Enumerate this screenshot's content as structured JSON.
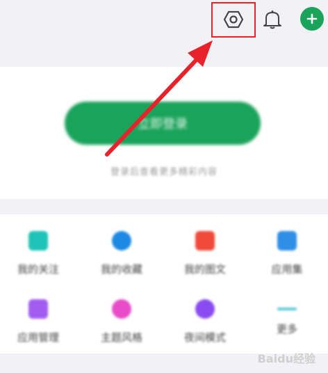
{
  "header": {
    "icons": [
      "gear-icon",
      "bell-icon",
      "plus-icon"
    ],
    "highlight_color": "#e8222a"
  },
  "login": {
    "button_label": "立即登录",
    "tip": "登录后查看更多精彩内容"
  },
  "grid": {
    "items": [
      {
        "label": "我的关注",
        "icon": "follow-icon",
        "color": "#1fc4b8"
      },
      {
        "label": "我的收藏",
        "icon": "star-icon",
        "color": "#1e88e5"
      },
      {
        "label": "我的图文",
        "icon": "document-icon",
        "color": "#f04a3a"
      },
      {
        "label": "应用集",
        "icon": "apps-icon",
        "color": "#2f8fe6"
      },
      {
        "label": "应用管理",
        "icon": "manage-icon",
        "color": "#a35cf0"
      },
      {
        "label": "主题风格",
        "icon": "theme-icon",
        "color": "#e84cc8"
      },
      {
        "label": "夜间模式",
        "icon": "moon-icon",
        "color": "#8a4cf0"
      },
      {
        "label": "更多",
        "icon": "more-icon",
        "color": "#57c9d6"
      }
    ]
  },
  "watermark": "Baidu经验",
  "colors": {
    "accent": "#1aa35a",
    "background": "#f2f2f6"
  }
}
